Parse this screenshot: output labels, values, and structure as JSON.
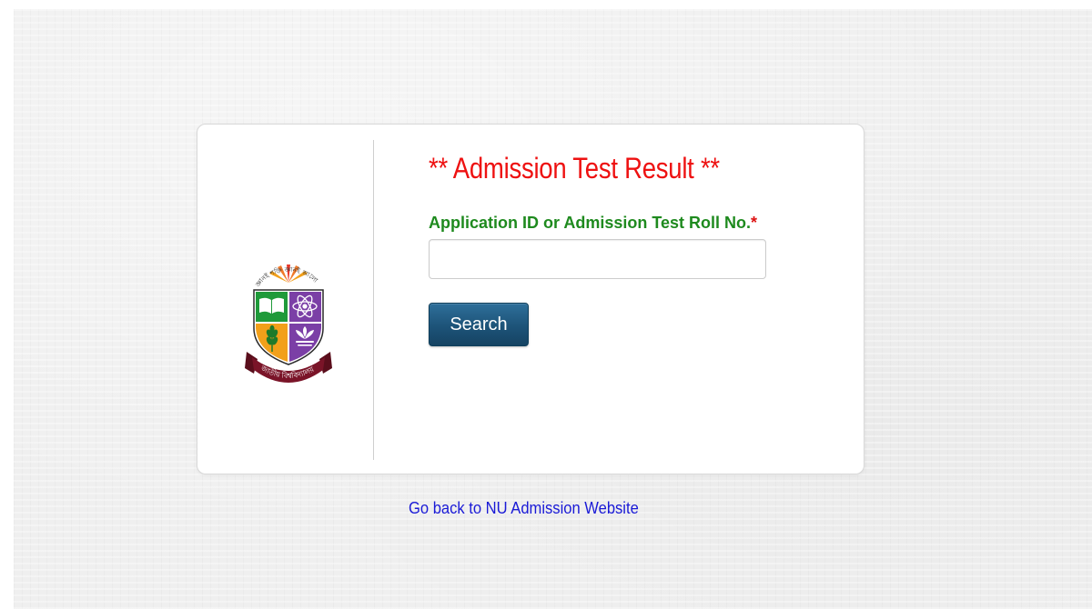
{
  "form": {
    "title": "** Admission Test Result **",
    "field_label": "Application ID or Admission Test Roll No.",
    "required_marker": "*",
    "input_value": "",
    "search_label": "Search"
  },
  "footer": {
    "back_link": "Go back to NU Admission Website"
  },
  "logo": {
    "top_arc_text": "জ্ঞানই শক্তি জ্ঞানই আলো",
    "ribbon_text": "জাতীয় বিশ্ববিদ্যালয়"
  },
  "colors": {
    "title_red": "#ee1111",
    "label_green": "#1e8a1e",
    "button_blue": "#1d5378",
    "link_blue": "#1a1ad6",
    "logo_green": "#1f9a3a",
    "logo_purple": "#7b3fa6",
    "logo_orange": "#f2a01a",
    "logo_maroon": "#7a1428"
  },
  "icons": {
    "logo": "national-university-emblem"
  }
}
